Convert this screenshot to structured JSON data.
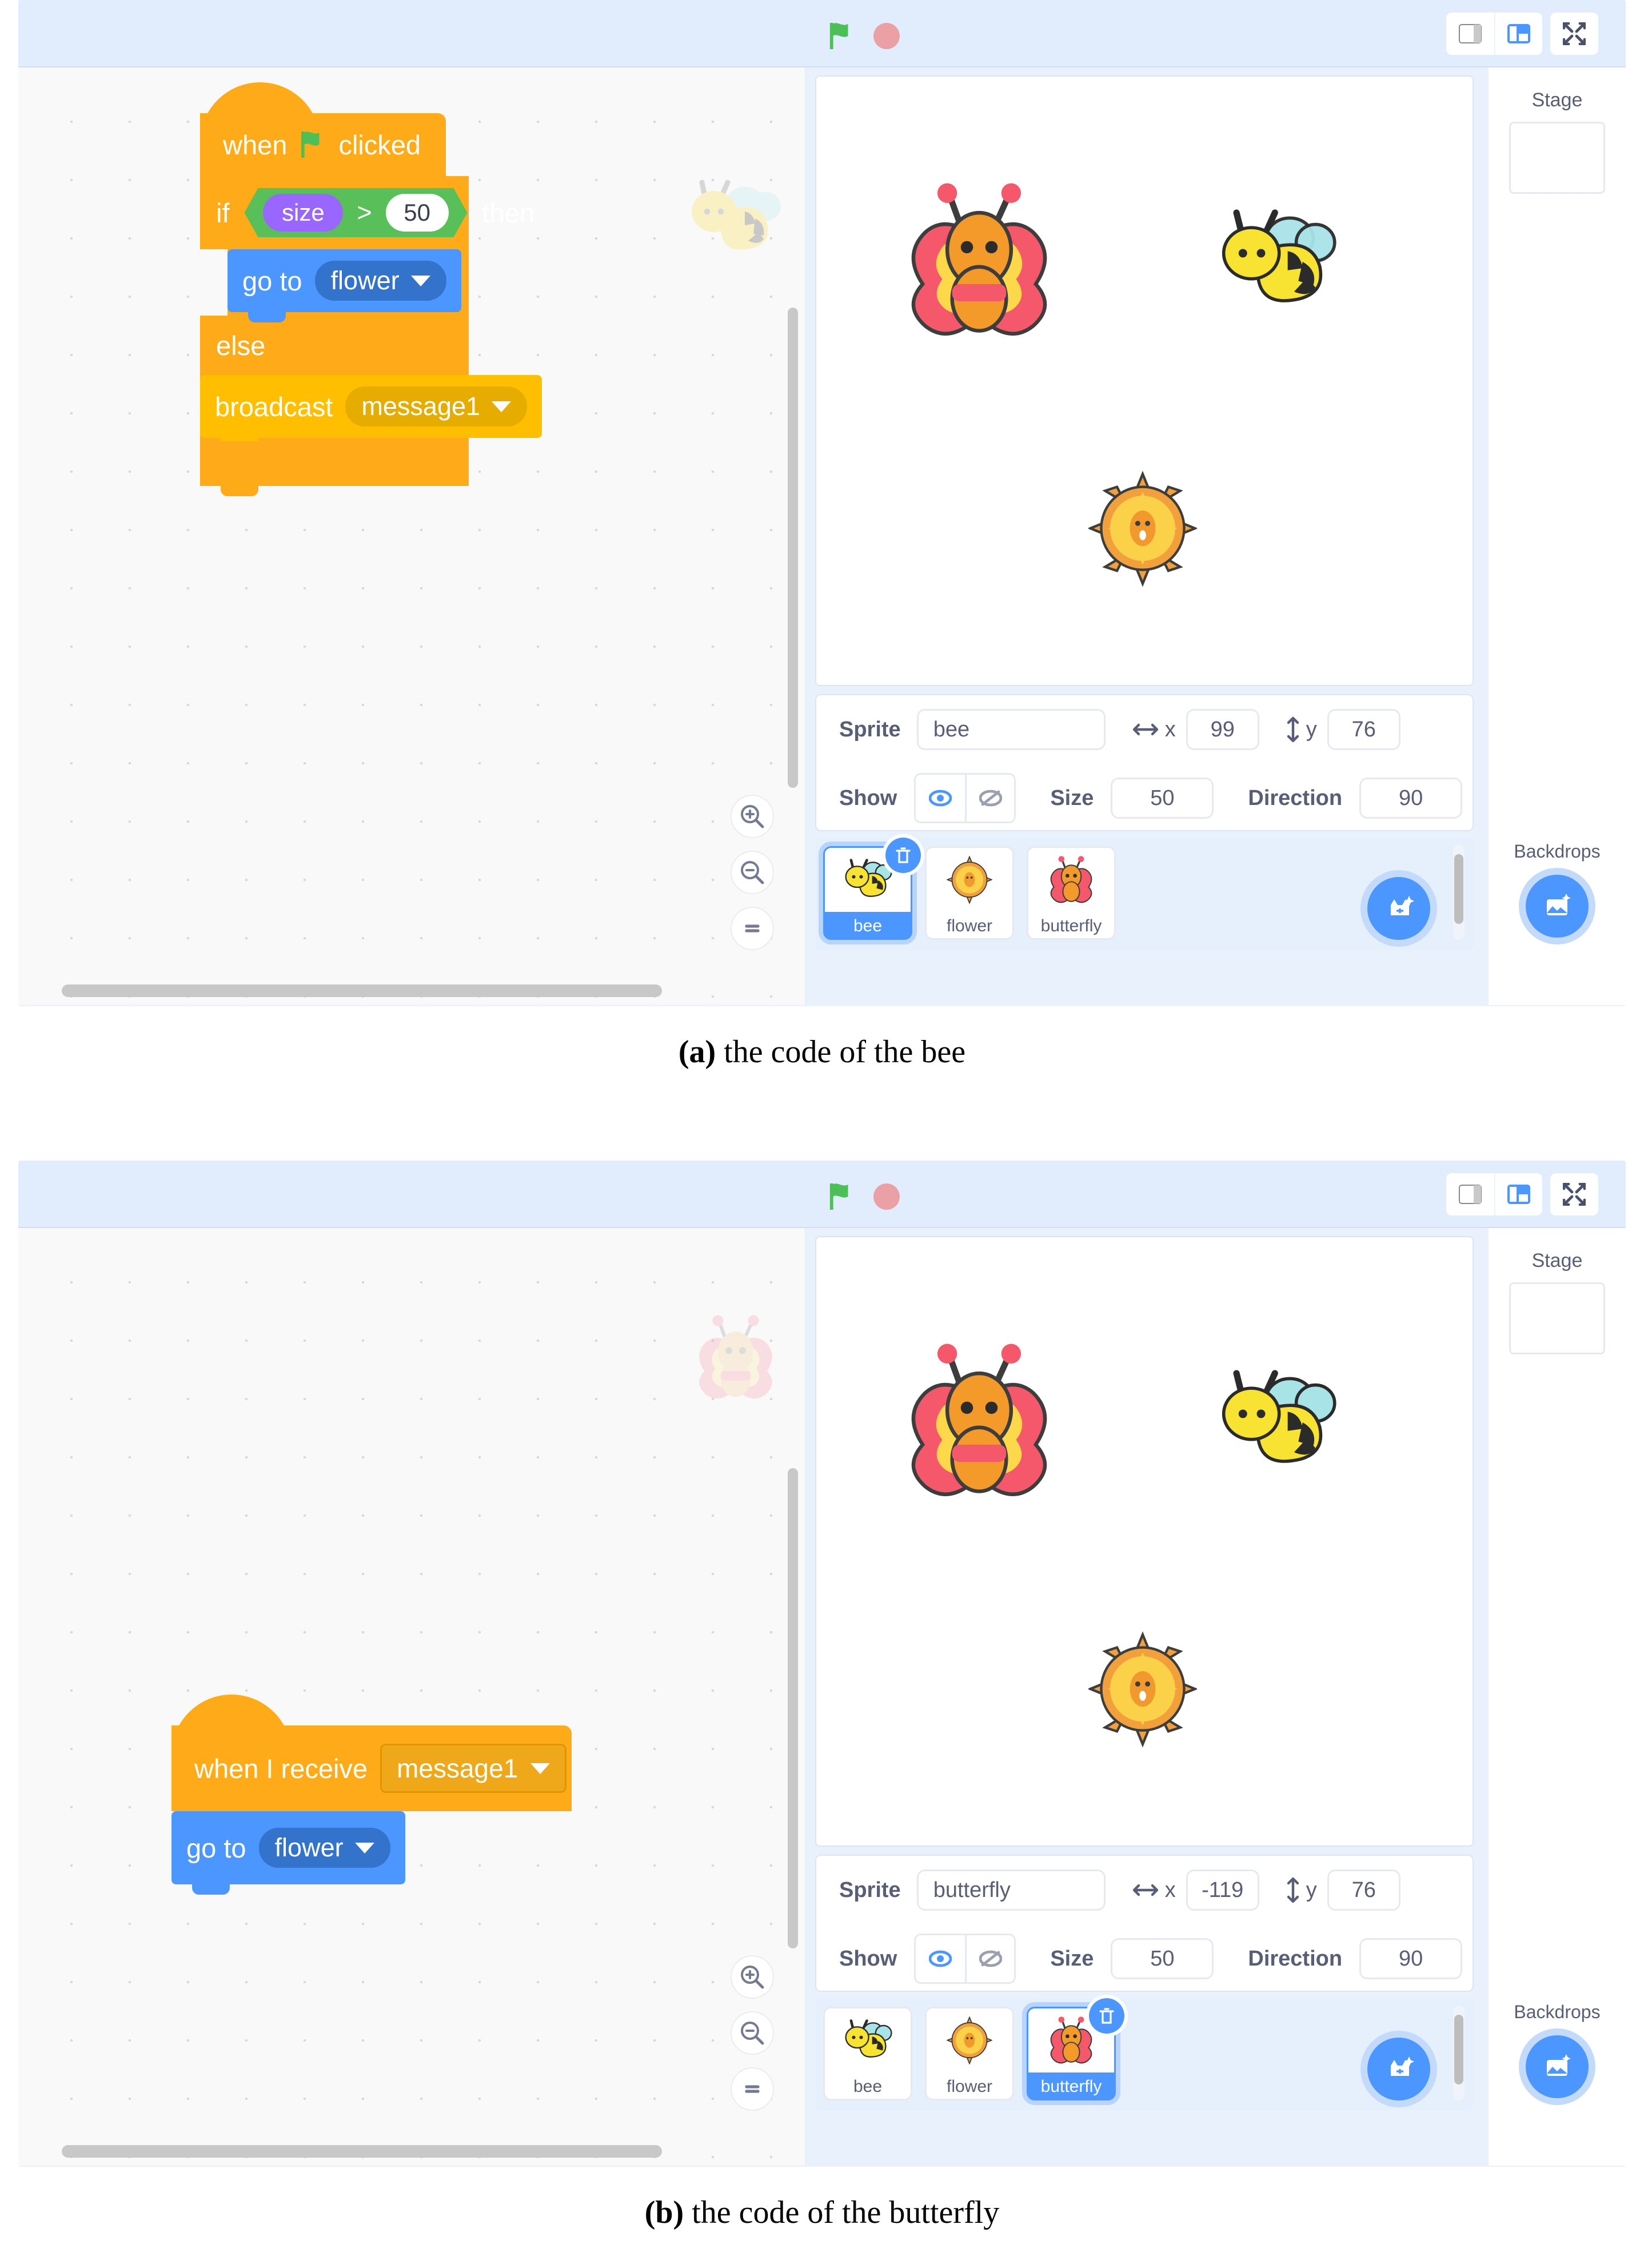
{
  "figures": [
    {
      "id": "a",
      "caption_label": "(a)",
      "caption_text": " the code of the bee",
      "toolbar": {
        "green_flag": "green-flag",
        "stop": "stop-sign",
        "small_stage_btn": "small-stage-layout",
        "large_stage_btn": "large-stage-layout",
        "fullscreen_btn": "fullscreen"
      },
      "code": {
        "watermark": "bee",
        "script": [
          {
            "type": "hat",
            "text_before": "when",
            "icon": "green-flag",
            "text_after": "clicked"
          },
          {
            "type": "if_else",
            "if_label": "if",
            "then_label": "then",
            "else_label": "else",
            "condition": {
              "operator": ">",
              "left": "size",
              "right": "50"
            },
            "if_body": [
              {
                "type": "motion",
                "label": "go to",
                "dropdown": "flower"
              }
            ],
            "else_body": [
              {
                "type": "event",
                "label": "broadcast",
                "dropdown": "message1"
              }
            ]
          }
        ],
        "zoom_in": "zoom-in",
        "zoom_out": "zoom-out",
        "zoom_reset": "zoom-reset"
      },
      "stage": {
        "sprites_on_stage": [
          "butterfly",
          "bee",
          "flower"
        ]
      },
      "sprite_info": {
        "sprite_label": "Sprite",
        "name": "bee",
        "x_label": "x",
        "x": "99",
        "y_label": "y",
        "y": "76",
        "show_label": "Show",
        "show_visible": true,
        "size_label": "Size",
        "size": "50",
        "direction_label": "Direction",
        "direction": "90"
      },
      "sprite_list": [
        {
          "name": "bee",
          "selected": true
        },
        {
          "name": "flower",
          "selected": false
        },
        {
          "name": "butterfly",
          "selected": false
        }
      ],
      "add_sprite_button": "add-sprite",
      "stage_panel": {
        "title": "Stage",
        "backdrops_label": "Backdrops",
        "add_backdrop_button": "add-backdrop"
      }
    },
    {
      "id": "b",
      "caption_label": "(b)",
      "caption_text": " the code of the butterfly",
      "toolbar": {
        "green_flag": "green-flag",
        "stop": "stop-sign",
        "small_stage_btn": "small-stage-layout",
        "large_stage_btn": "large-stage-layout",
        "fullscreen_btn": "fullscreen"
      },
      "code": {
        "watermark": "butterfly",
        "script": [
          {
            "type": "hat",
            "text_before": "when I receive",
            "dropdown": "message1"
          },
          {
            "type": "motion",
            "label": "go to",
            "dropdown": "flower"
          }
        ],
        "zoom_in": "zoom-in",
        "zoom_out": "zoom-out",
        "zoom_reset": "zoom-reset"
      },
      "stage": {
        "sprites_on_stage": [
          "butterfly",
          "bee",
          "flower"
        ]
      },
      "sprite_info": {
        "sprite_label": "Sprite",
        "name": "butterfly",
        "x_label": "x",
        "x": "-119",
        "y_label": "y",
        "y": "76",
        "show_label": "Show",
        "show_visible": true,
        "size_label": "Size",
        "size": "50",
        "direction_label": "Direction",
        "direction": "90"
      },
      "sprite_list": [
        {
          "name": "bee",
          "selected": false
        },
        {
          "name": "flower",
          "selected": false
        },
        {
          "name": "butterfly",
          "selected": true
        }
      ],
      "add_sprite_button": "add-sprite",
      "stage_panel": {
        "title": "Stage",
        "backdrops_label": "Backdrops",
        "add_backdrop_button": "add-backdrop"
      }
    }
  ],
  "colors": {
    "events_yellow": "#ffbf00",
    "control_orange": "#ffab19",
    "motion_blue": "#4c97ff",
    "operator_green": "#59c059",
    "variable_purple": "#9966ff",
    "ui_blue": "#4c97ff",
    "panel_bg": "#e8f1fc"
  }
}
